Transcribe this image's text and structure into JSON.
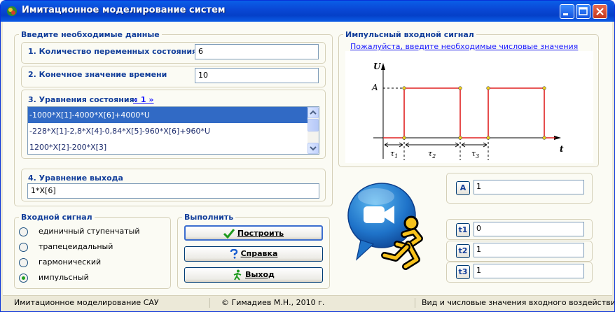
{
  "window": {
    "title": "Имитационное моделирование систем"
  },
  "input_group": {
    "legend": "Введите необходимые данные",
    "state_count": {
      "label": "1. Количество переменных состояния",
      "value": "6"
    },
    "end_time": {
      "label": "2. Конечное значение времени",
      "value": "10"
    },
    "state_eqs": {
      "label": "3. Уравнения состояния:",
      "link": "« 1 »",
      "items": [
        "-1000*X[1]-4000*X[6]+4000*U",
        "-228*X[1]-2,8*X[4]-0,84*X[5]-960*X[6]+960*U",
        "1200*X[2]-200*X[3]"
      ],
      "selected_index": 0
    },
    "output_eq": {
      "label": "4. Уравнение выхода",
      "value": "1*X[6]"
    }
  },
  "input_signal": {
    "legend": "Входной сигнал",
    "options": [
      "единичный ступенчатый",
      "трапецеидальный",
      "гармонический",
      "импульсный"
    ],
    "selected_index": 3
  },
  "run": {
    "legend": "Выполнить",
    "build_label": "Построить",
    "help_label": "Справка",
    "exit_label": "Выход"
  },
  "pulse": {
    "legend": "Импульсный входной сигнал",
    "hint": "Пожалуйста, введите необходимые числовые значения",
    "chart_text": {
      "y_axis": "U",
      "x_axis": "t",
      "amp": "A",
      "t1": "τ",
      "t2": "τ",
      "t3": "τ",
      "s1": "1",
      "s2": "2",
      "s3": "3"
    },
    "params": [
      {
        "name": "A",
        "value": "1"
      },
      {
        "name": "t1",
        "value": "0"
      },
      {
        "name": "t2",
        "value": "1"
      },
      {
        "name": "t3",
        "value": "1"
      }
    ]
  },
  "statusbar": {
    "left": "Имитационное моделирование САУ",
    "center": "© Гимадиев М.Н., 2010 г.",
    "right": "Вид и числовые значения входного воздействия"
  },
  "colors": {
    "accent": "#123E9A",
    "signal_line": "#E02020",
    "selection": "#316AC5"
  }
}
